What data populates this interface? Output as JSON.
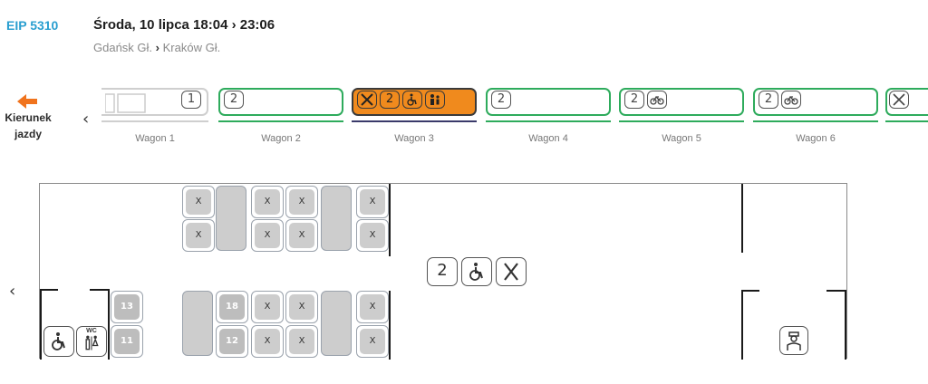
{
  "train": {
    "number": "EIP 5310"
  },
  "trip": {
    "date_time": "Środa, 10 lipca 18:04 › 23:06",
    "from": "Gdańsk Gł.",
    "separator": "›",
    "to": "Kraków Gł."
  },
  "direction": {
    "line1": "Kierunek",
    "line2": "jazdy",
    "icon": "arrow-left-icon"
  },
  "nav": {
    "prev_wagon": "‹",
    "prev_view": "‹"
  },
  "wagons": [
    {
      "label": "Wagon 1",
      "class": "1",
      "state": "ghost"
    },
    {
      "label": "Wagon 2",
      "class": "2",
      "state": "available"
    },
    {
      "label": "Wagon 3",
      "class": "2",
      "state": "selected",
      "features": [
        "restaurant-icon",
        "wheelchair-icon",
        "family-icon"
      ]
    },
    {
      "label": "Wagon 4",
      "class": "2",
      "state": "available"
    },
    {
      "label": "Wagon 5",
      "class": "2",
      "state": "available",
      "features": [
        "bicycle-icon"
      ]
    },
    {
      "label": "Wagon 6",
      "class": "2",
      "state": "available",
      "features": [
        "bicycle-icon"
      ]
    }
  ],
  "coach": {
    "class_badge": "2",
    "features": [
      "wheelchair-icon",
      "restaurant-icon"
    ],
    "wc_label": "WC",
    "seat_mark": "X",
    "seats_free": [
      "13",
      "11",
      "18",
      "12"
    ]
  },
  "colors": {
    "accent": "#2a9fd0",
    "available": "#2eab5c",
    "selected": "#f08a1d",
    "seat": "#cdcdcd"
  }
}
